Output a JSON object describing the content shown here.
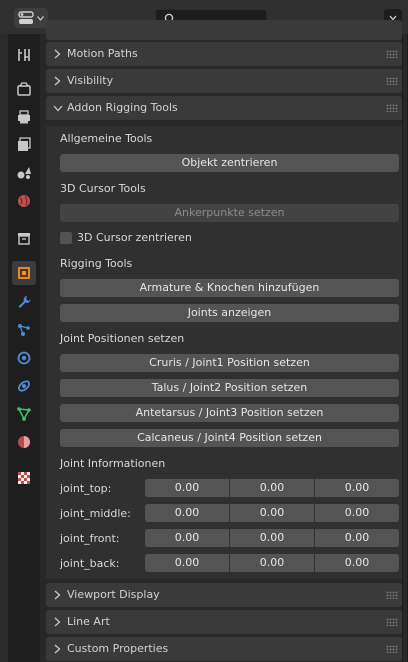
{
  "header": {
    "editor_icon": "properties-editor-icon",
    "search_placeholder": "",
    "options_icon": "chevron-down-icon"
  },
  "tabs": [
    {
      "name": "tool-icon"
    },
    {
      "name": "render-icon"
    },
    {
      "name": "output-icon"
    },
    {
      "name": "view-layer-icon"
    },
    {
      "name": "scene-icon"
    },
    {
      "name": "world-icon"
    },
    {
      "name": "collection-icon"
    },
    {
      "name": "object-icon",
      "active": true
    },
    {
      "name": "modifier-icon"
    },
    {
      "name": "particles-icon"
    },
    {
      "name": "physics-icon"
    },
    {
      "name": "constraints-icon"
    },
    {
      "name": "data-icon"
    },
    {
      "name": "material-icon"
    },
    {
      "name": "texture-icon"
    }
  ],
  "panels": {
    "motion_paths": "Motion Paths",
    "visibility": "Visibility",
    "addon": "Addon Rigging Tools",
    "viewport_display": "Viewport Display",
    "line_art": "Line Art",
    "custom_properties": "Custom Properties"
  },
  "addon": {
    "general_label": "Allgemeine Tools",
    "center_object_btn": "Objekt zentrieren",
    "cursor_label": "3D Cursor Tools",
    "set_anchor_btn": "Ankerpunkte setzen",
    "center_cursor_label": "3D Cursor zentrieren",
    "rigging_label": "Rigging Tools",
    "add_armature_btn": "Armature & Knochen hinzufügen",
    "show_joints_btn": "Joints anzeigen",
    "joint_positions_label": "Joint Positionen setzen",
    "joint1_btn": "Cruris / Joint1 Position setzen",
    "joint2_btn": "Talus / Joint2 Position setzen",
    "joint3_btn": "Antetarsus / Joint3 Position setzen",
    "joint4_btn": "Calcaneus / Joint4 Position setzen",
    "joint_info_label": "Joint Informationen",
    "rows": [
      {
        "label": "joint_top:",
        "v1": "0.00",
        "v2": "0.00",
        "v3": "0.00"
      },
      {
        "label": "joint_middle:",
        "v1": "0.00",
        "v2": "0.00",
        "v3": "0.00"
      },
      {
        "label": "joint_front:",
        "v1": "0.00",
        "v2": "0.00",
        "v3": "0.00"
      },
      {
        "label": "joint_back:",
        "v1": "0.00",
        "v2": "0.00",
        "v3": "0.00"
      }
    ]
  }
}
